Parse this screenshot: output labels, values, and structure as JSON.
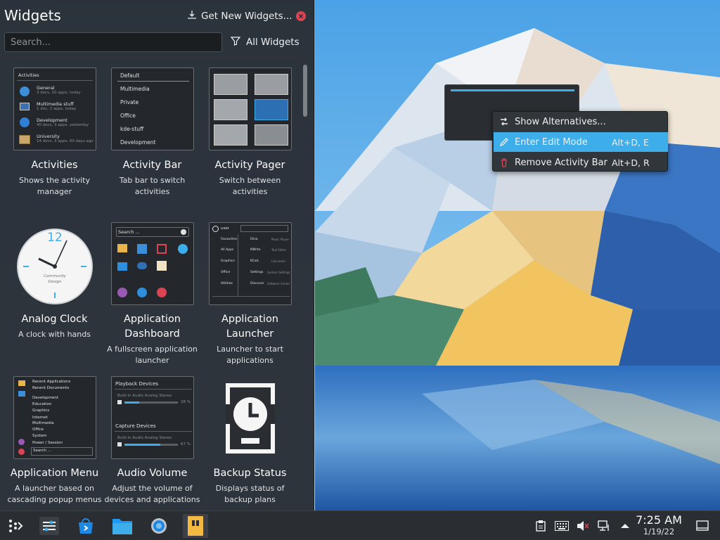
{
  "sidebar": {
    "title": "Widgets",
    "get_new_label": "Get New Widgets...",
    "search_placeholder": "Search...",
    "filter_label": "All Widgets"
  },
  "widgets": [
    {
      "name": "Activities",
      "desc": [
        "Shows the activity",
        "manager"
      ]
    },
    {
      "name": "Activity Bar",
      "desc": [
        "Tab bar to switch",
        "activities"
      ]
    },
    {
      "name": "Activity Pager",
      "desc": [
        "Switch between",
        "activities"
      ]
    },
    {
      "name": "Analog Clock",
      "desc": [
        "A clock with hands"
      ]
    },
    {
      "name": "Application Dashboard",
      "name_lines": [
        "Application",
        "Dashboard"
      ],
      "desc": [
        "A fullscreen application",
        "launcher"
      ]
    },
    {
      "name": "Application Launcher",
      "name_lines": [
        "Application",
        "Launcher"
      ],
      "desc": [
        "Launcher to start",
        "applications"
      ]
    },
    {
      "name": "Application Menu",
      "desc": [
        "A launcher based on",
        "cascading popup menus"
      ]
    },
    {
      "name": "Audio Volume",
      "desc": [
        "Adjust the volume of",
        "devices and applications"
      ]
    },
    {
      "name": "Backup Status",
      "desc": [
        "Displays status of",
        "backup plans"
      ]
    }
  ],
  "thumbs": {
    "activities": {
      "header": "Activities",
      "items": [
        {
          "title": "General",
          "sub": "3 docs, 10 apps, today"
        },
        {
          "title": "Multimedia stuff",
          "sub": "1 doc, 2 apps, today"
        },
        {
          "title": "Development",
          "sub": "40 docs, 3 apps, yesterday"
        },
        {
          "title": "University",
          "sub": "14 docs, 3 apps, 60 days ago"
        }
      ]
    },
    "activity_bar": {
      "items": [
        "Default",
        "Multimedia",
        "Private",
        "Office",
        "kde-stuff",
        "Development"
      ]
    },
    "dashboard": {
      "search": "Search ..."
    },
    "launcher": {
      "user": "user",
      "left": [
        "Favourites",
        "All Apps",
        "Graphics",
        "Office",
        "Utilities"
      ],
      "right": [
        "Elisa",
        "KWrite",
        "KCalc",
        "Settings",
        "Discover"
      ],
      "right_sub": [
        "Music Player",
        "Text Editor",
        "Calculator",
        "System Settings",
        "Software Center"
      ]
    },
    "app_menu": {
      "items": [
        "Recent Applications",
        "Recent Documents",
        "Development",
        "Education",
        "Graphics",
        "Internet",
        "Multimedia",
        "Office",
        "System",
        "Power / Session"
      ],
      "search": "Search ..."
    },
    "audio": {
      "playback_header": "Playback Devices",
      "playback_device": "Built-in Audio Analog Stereo",
      "playback_pct": "28 %",
      "playback_level": 0.28,
      "capture_header": "Capture Devices",
      "capture_device": "Built-in Audio Analog Stereo",
      "capture_pct": "67 %",
      "capture_level": 0.67
    },
    "clock": {
      "numeral": "12",
      "brand": [
        "Community",
        "Design"
      ]
    }
  },
  "context_menu": {
    "items": [
      {
        "label": "Show Alternatives...",
        "shortcut": "",
        "icon": "alternatives-icon"
      },
      {
        "label": "Enter Edit Mode",
        "shortcut": "Alt+D, E",
        "icon": "pencil-icon",
        "highlighted": true
      },
      {
        "label": "Remove Activity Bar",
        "shortcut": "Alt+D, R",
        "icon": "trash-icon"
      }
    ]
  },
  "panel": {
    "clock_time": "7:25 AM",
    "clock_date": "1/19/22",
    "taskbar": [
      "kickoff-launcher-icon",
      "settings-sliders-icon",
      "discover-store-icon",
      "dolphin-folder-icon",
      "system-settings-gear-icon",
      "archive-icon"
    ],
    "tray": [
      "clipboard-icon",
      "keyboard-icon",
      "audio-muted-icon",
      "network-icon",
      "expand-tray-icon"
    ]
  },
  "colors": {
    "accent": "#3daee9",
    "close": "#da4453",
    "panel": "#2a2e32",
    "sidebar": "#2a2e32"
  }
}
